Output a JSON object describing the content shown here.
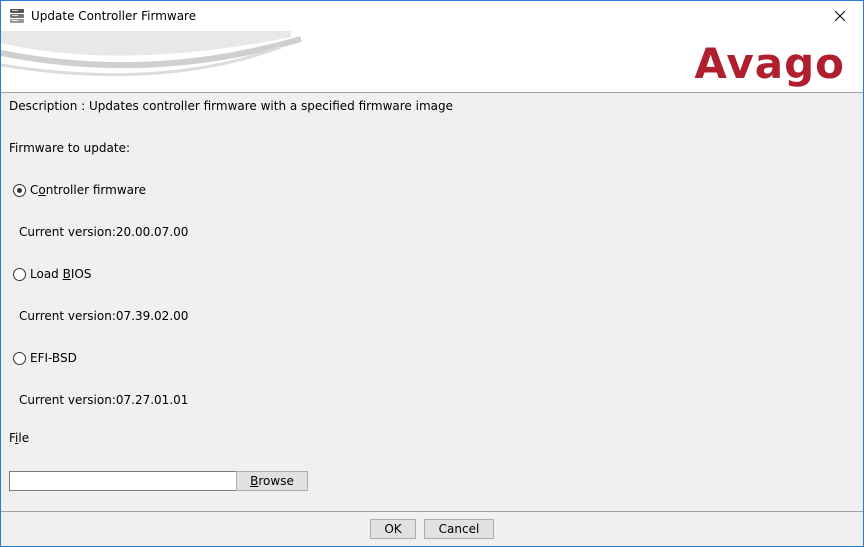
{
  "window": {
    "title": "Update Controller Firmware",
    "icon": "stacked-disks-icon",
    "close_icon": "close-icon"
  },
  "banner": {
    "logo_text": "Avago",
    "logo_color": "#b01f2e"
  },
  "content": {
    "description": "Description : Updates controller firmware with a specified firmware image",
    "firmware_label": "Firmware to update:",
    "options": [
      {
        "label_first": "C",
        "label_ul": "o",
        "label_rest": "ntroller firmware",
        "version": "Current version:20.00.07.00",
        "selected": true
      },
      {
        "label_first": "Load ",
        "label_ul": "B",
        "label_rest": "IOS",
        "version": "Current version:07.39.02.00",
        "selected": false
      },
      {
        "label_first": "EFI-BSD",
        "label_ul": "",
        "label_rest": "",
        "version": "Current version:07.27.01.01",
        "selected": false
      }
    ],
    "file_label_first": "F",
    "file_label_ul": "i",
    "file_label_rest": "le",
    "file_value": "",
    "browse_first": "",
    "browse_ul": "B",
    "browse_rest": "rowse"
  },
  "footer": {
    "ok_label": "OK",
    "cancel_label": "Cancel"
  }
}
